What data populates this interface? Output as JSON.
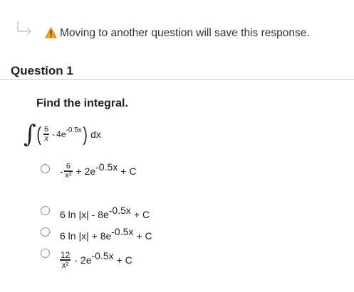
{
  "warning": {
    "text": "Moving to another question will save this response."
  },
  "question": {
    "title": "Question 1",
    "prompt": "Find the integral."
  },
  "integral": {
    "open": "(",
    "frac_num": "6",
    "frac_den": "x",
    "minus": "-",
    "coef": "4e",
    "exp": "-0.5x",
    "close": ")",
    "dx": "dx"
  },
  "options": [
    {
      "lead": "-",
      "num": "6",
      "den": "x²",
      "mid": "+ 2e",
      "sup": "-0.5x",
      "tail": "+ C"
    },
    {
      "text": "6 ln |x| - 8e",
      "sup": "-0.5x",
      "tail": "+ C"
    },
    {
      "text": "6 ln |x| + 8e",
      "sup": "-0.5x",
      "tail": "+ C"
    },
    {
      "num": "12",
      "den": "x²",
      "mid": "- 2e",
      "sup": "-0.5x",
      "tail": "+ C"
    }
  ]
}
